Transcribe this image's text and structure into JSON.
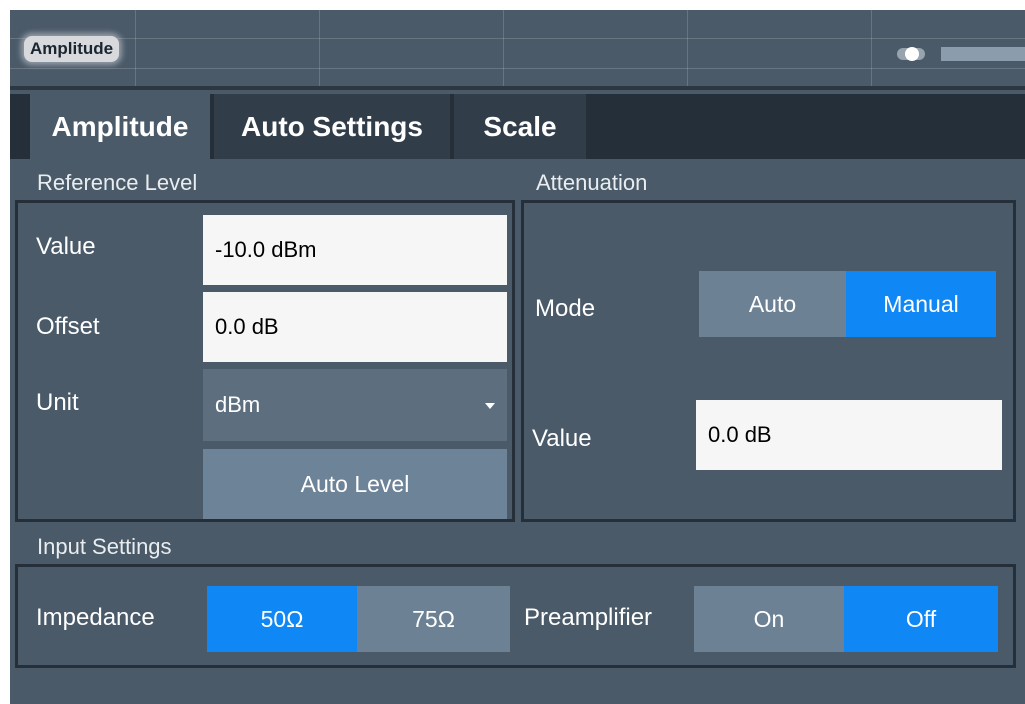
{
  "window": {
    "title": "Amplitude"
  },
  "tabs": [
    {
      "label": "Amplitude",
      "active": true
    },
    {
      "label": "Auto Settings",
      "active": false
    },
    {
      "label": "Scale",
      "active": false
    }
  ],
  "reference_level": {
    "section_title": "Reference Level",
    "value_label": "Value",
    "value": "-10.0 dBm",
    "offset_label": "Offset",
    "offset": "0.0 dB",
    "unit_label": "Unit",
    "unit_selected": "dBm",
    "auto_level_button": "Auto Level"
  },
  "attenuation": {
    "section_title": "Attenuation",
    "mode_label": "Mode",
    "mode_options": [
      "Auto",
      "Manual"
    ],
    "mode_selected": "Manual",
    "value_label": "Value",
    "value": "0.0 dB"
  },
  "input_settings": {
    "section_title": "Input Settings",
    "impedance_label": "Impedance",
    "impedance_options": [
      "50Ω",
      "75Ω"
    ],
    "impedance_selected": "50Ω",
    "preamplifier_label": "Preamplifier",
    "preamplifier_options": [
      "On",
      "Off"
    ],
    "preamplifier_selected": "Off"
  },
  "colors": {
    "background": "#4a5a69",
    "tabbar": "#252f39",
    "selected_accent": "#0f87f5",
    "button": "#6c8194",
    "input_bg": "#f6f6f6"
  },
  "icons": {
    "toggle": "toggle-icon",
    "bar": "minimize-bar-icon",
    "dropdown": "chevron-down-icon"
  }
}
